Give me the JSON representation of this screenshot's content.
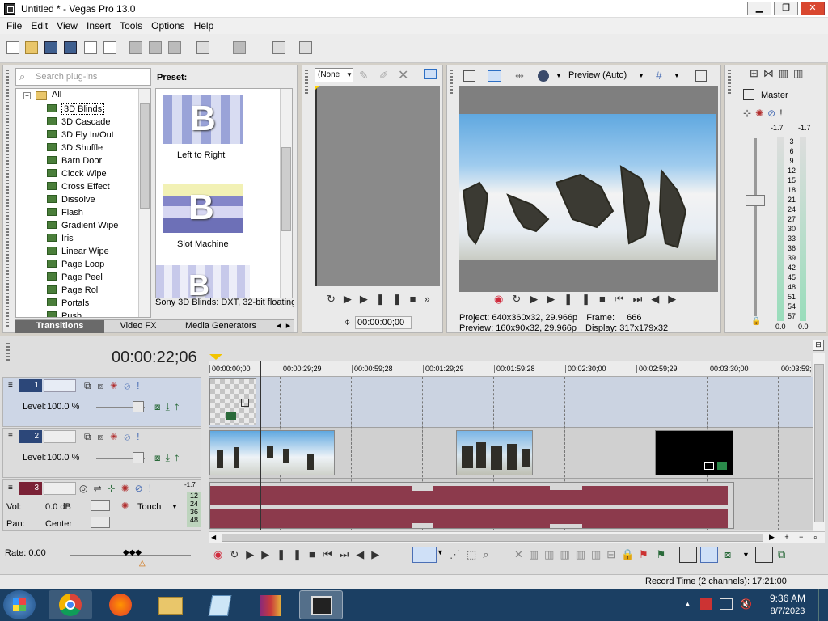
{
  "window": {
    "title": "Untitled * - Vegas Pro 13.0"
  },
  "menu": [
    "File",
    "Edit",
    "View",
    "Insert",
    "Tools",
    "Options",
    "Help"
  ],
  "plugin_panel": {
    "search_placeholder": "Search plug-ins",
    "root_label": "All",
    "items": [
      "3D Blinds",
      "3D Cascade",
      "3D Fly In/Out",
      "3D Shuffle",
      "Barn Door",
      "Clock Wipe",
      "Cross Effect",
      "Dissolve",
      "Flash",
      "Gradient Wipe",
      "Iris",
      "Linear Wipe",
      "Page Loop",
      "Page Peel",
      "Page Roll",
      "Portals",
      "Push"
    ],
    "selected_index": 0,
    "preset_label": "Preset:",
    "presets": [
      "Left to Right",
      "Slot Machine"
    ],
    "preset_status": "Sony 3D Blinds: DXT, 32-bit floating",
    "tabs": [
      "Transitions",
      "Video FX",
      "Media Generators"
    ],
    "active_tab": 0
  },
  "trimmer": {
    "dropdown": "(None",
    "timecode": "00:00:00;00"
  },
  "preview": {
    "mode": "Preview (Auto)",
    "info": {
      "project_label": "Project:",
      "project_value": "640x360x32, 29.966p",
      "preview_label": "Preview:",
      "preview_value": "160x90x32, 29.966p",
      "frame_label": "Frame:",
      "frame_value": "666",
      "display_label": "Display:",
      "display_value": "317x179x32"
    }
  },
  "master": {
    "label": "Master",
    "peak_left": "-1.7",
    "peak_right": "-1.7",
    "scale": [
      "3",
      "6",
      "9",
      "12",
      "15",
      "18",
      "21",
      "24",
      "27",
      "30",
      "33",
      "36",
      "39",
      "42",
      "45",
      "48",
      "51",
      "54",
      "57"
    ],
    "bottom_left": "0.0",
    "bottom_right": "0.0"
  },
  "timeline": {
    "current_time": "00:00:22;06",
    "ruler": [
      "00:00:00;00",
      "00:00:29;29",
      "00:00:59;28",
      "00:01:29;29",
      "00:01:59;28",
      "00:02:30;00",
      "00:02:59;29",
      "00:03:30;00",
      "00:03:59;"
    ],
    "tracks": [
      {
        "num": "1",
        "level_label": "Level:",
        "level_value": "100.0 %"
      },
      {
        "num": "2",
        "level_label": "Level:",
        "level_value": "100.0 %"
      },
      {
        "num": "3",
        "vol_label": "Vol:",
        "vol_value": "0.0 dB",
        "pan_label": "Pan:",
        "pan_value": "Center",
        "touch": "Touch",
        "peak": "-1.7",
        "meter": [
          "12",
          "24",
          "36",
          "48"
        ]
      }
    ],
    "rate": "Rate: 0.00"
  },
  "status": {
    "record_time": "Record Time (2 channels): 17:21:00"
  },
  "taskbar": {
    "time": "9:36 AM",
    "date": "8/7/2023"
  },
  "colors": {
    "audio_wave": "#8c3a4c",
    "accent": "#4b6fb5"
  }
}
